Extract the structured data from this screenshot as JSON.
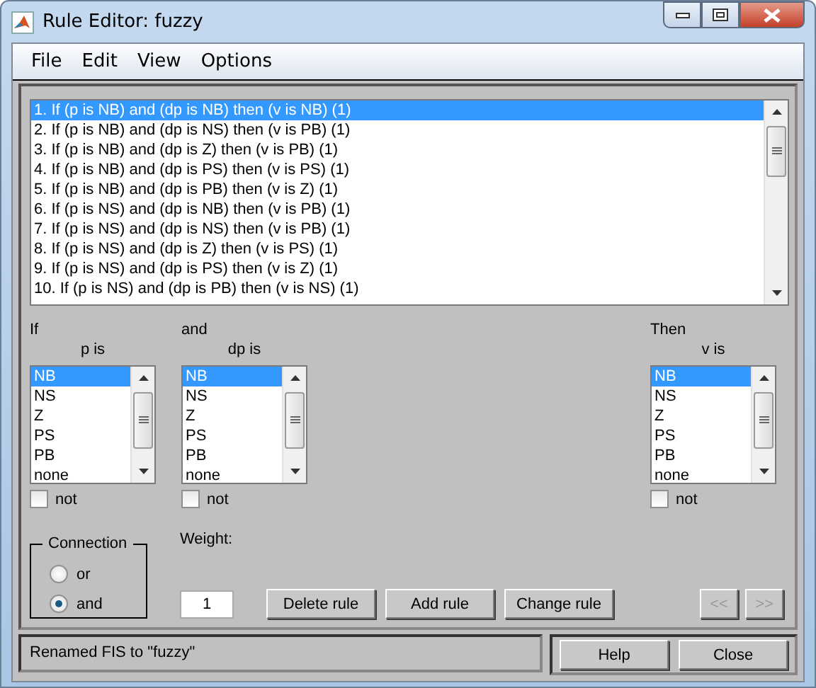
{
  "window": {
    "title": "Rule Editor: fuzzy"
  },
  "menu": [
    "File",
    "Edit",
    "View",
    "Options"
  ],
  "rules": [
    {
      "text": "1. If (p is NB) and (dp is NB) then (v is NB) (1)",
      "selected": true
    },
    {
      "text": "2. If (p is NB) and (dp is NS) then (v is PB) (1)",
      "selected": false
    },
    {
      "text": "3. If (p is NB) and (dp is Z) then (v is PB) (1)",
      "selected": false
    },
    {
      "text": "4. If (p is NB) and (dp is PS) then (v is PS) (1)",
      "selected": false
    },
    {
      "text": "5. If (p is NB) and (dp is PB) then (v is Z) (1)",
      "selected": false
    },
    {
      "text": "6. If (p is NS) and (dp is NB) then (v is PB) (1)",
      "selected": false
    },
    {
      "text": "7. If (p is NS) and (dp is NS) then (v is PB) (1)",
      "selected": false
    },
    {
      "text": "8. If (p is NS) and (dp is Z) then (v is PS) (1)",
      "selected": false
    },
    {
      "text": "9. If (p is NS) and (dp is PS) then (v is Z) (1)",
      "selected": false
    },
    {
      "text": "10. If (p is NS) and (dp is PB) then (v is NS) (1)",
      "selected": false
    }
  ],
  "selectors": [
    {
      "heading": "If",
      "label": "p is",
      "items": [
        {
          "text": "NB",
          "selected": true
        },
        {
          "text": "NS",
          "selected": false
        },
        {
          "text": "Z",
          "selected": false
        },
        {
          "text": "PS",
          "selected": false
        },
        {
          "text": "PB",
          "selected": false
        },
        {
          "text": "none",
          "selected": false
        }
      ],
      "not_label": "not",
      "not_checked": false
    },
    {
      "heading": "and",
      "label": "dp is",
      "items": [
        {
          "text": "NB",
          "selected": true
        },
        {
          "text": "NS",
          "selected": false
        },
        {
          "text": "Z",
          "selected": false
        },
        {
          "text": "PS",
          "selected": false
        },
        {
          "text": "PB",
          "selected": false
        },
        {
          "text": "none",
          "selected": false
        }
      ],
      "not_label": "not",
      "not_checked": false
    },
    {
      "heading": "Then",
      "label": "v is",
      "items": [
        {
          "text": "NB",
          "selected": true
        },
        {
          "text": "NS",
          "selected": false
        },
        {
          "text": "Z",
          "selected": false
        },
        {
          "text": "PS",
          "selected": false
        },
        {
          "text": "PB",
          "selected": false
        },
        {
          "text": "none",
          "selected": false
        }
      ],
      "not_label": "not",
      "not_checked": false
    }
  ],
  "connection": {
    "title": "Connection",
    "options": [
      {
        "label": "or",
        "selected": false
      },
      {
        "label": "and",
        "selected": true
      }
    ]
  },
  "weight": {
    "label": "Weight:",
    "value": "1"
  },
  "buttons": [
    {
      "label": "Delete rule",
      "disabled": false
    },
    {
      "label": "Add rule",
      "disabled": false
    },
    {
      "label": "Change rule",
      "disabled": false
    }
  ],
  "nav_buttons": [
    {
      "label": "<<",
      "disabled": true
    },
    {
      "label": ">>",
      "disabled": true
    }
  ],
  "status": "Renamed FIS to \"fuzzy\"",
  "footer_buttons": [
    "Help",
    "Close"
  ]
}
